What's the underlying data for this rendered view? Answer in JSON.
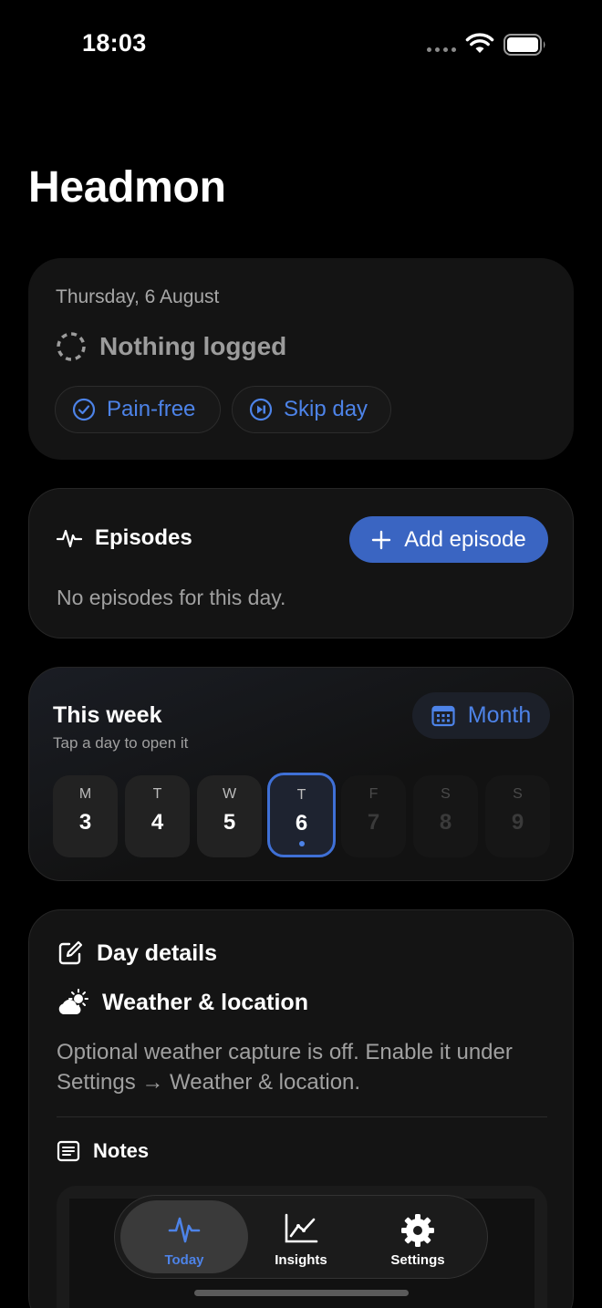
{
  "status_bar": {
    "time": "18:03"
  },
  "app": {
    "title": "Headmon"
  },
  "summary": {
    "date": "Thursday, 6 August",
    "status": "Nothing logged",
    "pain_free_label": "Pain-free",
    "skip_day_label": "Skip day"
  },
  "episodes": {
    "title": "Episodes",
    "add_label": "Add episode",
    "empty_text": "No episodes for this day."
  },
  "week": {
    "title": "This week",
    "subtitle": "Tap a day to open it",
    "month_label": "Month",
    "days": [
      {
        "letter": "M",
        "number": "3",
        "state": "past"
      },
      {
        "letter": "T",
        "number": "4",
        "state": "past"
      },
      {
        "letter": "W",
        "number": "5",
        "state": "past"
      },
      {
        "letter": "T",
        "number": "6",
        "state": "selected"
      },
      {
        "letter": "F",
        "number": "7",
        "state": "future"
      },
      {
        "letter": "S",
        "number": "8",
        "state": "future"
      },
      {
        "letter": "S",
        "number": "9",
        "state": "future"
      }
    ]
  },
  "details": {
    "title": "Day details",
    "weather_title": "Weather & location",
    "weather_text": "Optional weather capture is off. Enable it under Settings → Weather & location.",
    "notes_title": "Notes"
  },
  "tabs": [
    {
      "label": "Today",
      "icon": "pulse-icon",
      "active": true
    },
    {
      "label": "Insights",
      "icon": "chart-icon",
      "active": false
    },
    {
      "label": "Settings",
      "icon": "gear-icon",
      "active": false
    }
  ],
  "colors": {
    "accent": "#4d83e8",
    "primary_button": "#3a65c2",
    "background": "#000000",
    "card": "#141414"
  }
}
